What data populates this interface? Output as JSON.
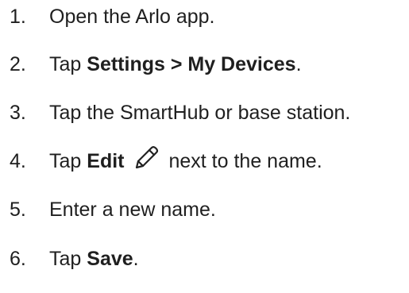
{
  "steps": [
    {
      "number": "1.",
      "parts": [
        {
          "text": "Open the Arlo app.",
          "bold": false
        }
      ]
    },
    {
      "number": "2.",
      "parts": [
        {
          "text": "Tap ",
          "bold": false
        },
        {
          "text": "Settings > My Devices",
          "bold": true
        },
        {
          "text": ".",
          "bold": false
        }
      ]
    },
    {
      "number": "3.",
      "parts": [
        {
          "text": "Tap the SmartHub or base station.",
          "bold": false
        }
      ]
    },
    {
      "number": "4.",
      "parts": [
        {
          "text": "Tap ",
          "bold": false
        },
        {
          "text": "Edit",
          "bold": true
        },
        {
          "text": "next to the name.",
          "bold": false
        }
      ],
      "icon": "pencil-edit-icon"
    },
    {
      "number": "5.",
      "parts": [
        {
          "text": "Enter a new name.",
          "bold": false
        }
      ]
    },
    {
      "number": "6.",
      "parts": [
        {
          "text": "Tap ",
          "bold": false
        },
        {
          "text": "Save",
          "bold": true
        },
        {
          "text": ".",
          "bold": false
        }
      ]
    }
  ]
}
